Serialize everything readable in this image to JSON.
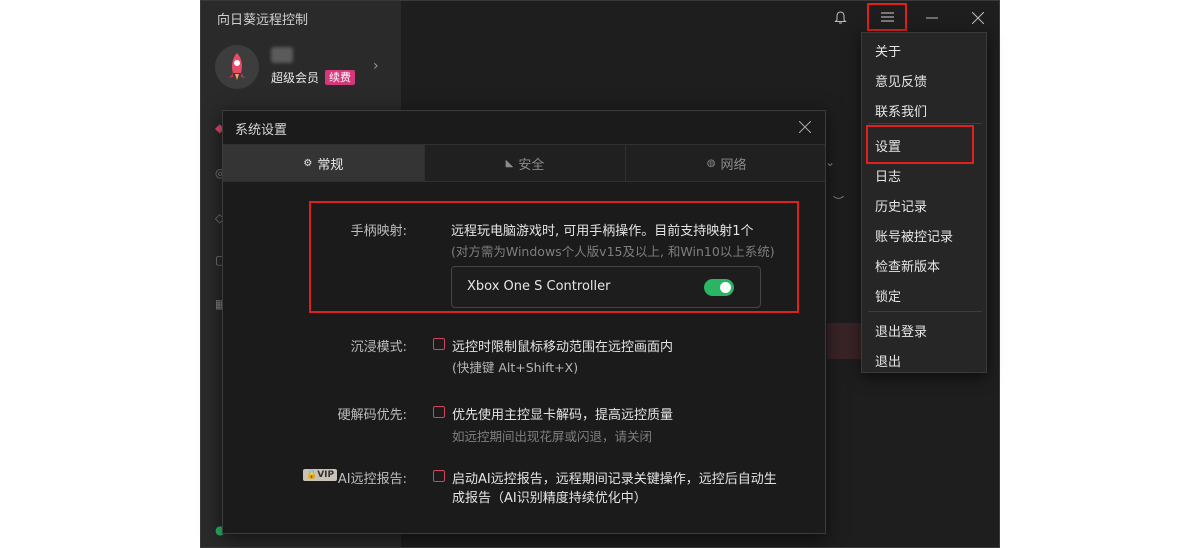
{
  "app": {
    "title": "向日葵远程控制",
    "member_label": "超级会员",
    "renew_badge": "续费"
  },
  "dialog": {
    "title": "系统设置",
    "tabs": [
      {
        "label": "常规",
        "icon": "gear-icon",
        "active": true
      },
      {
        "label": "安全",
        "icon": "shield-icon",
        "active": false
      },
      {
        "label": "网络",
        "icon": "globe-icon",
        "active": false
      }
    ],
    "gamepad": {
      "label": "手柄映射:",
      "text": "远程玩电脑游戏时, 可用手柄操作。目前支持映射1个",
      "sub": "(对方需为Windows个人版v15及以上, 和Win10以上系统)",
      "device": "Xbox One S Controller",
      "enabled": true
    },
    "immersive": {
      "label": "沉浸模式:",
      "text": "远控时限制鼠标移动范围在远控画面内",
      "sub": "(快捷键 Alt+Shift+X)",
      "checked": false
    },
    "hw_decode": {
      "label": "硬解码优先:",
      "text": "优先使用主控显卡解码，提高远控质量",
      "sub": "如远控期间出现花屏或闪退，请关闭",
      "checked": false
    },
    "ai_report": {
      "vip": "VIP",
      "label": "AI远控报告:",
      "text_line1": "启动AI远控报告，远程期间记录关键操作，远控后自动生",
      "text_line2": "成报告（AI识别精度持续优化中）",
      "checked": false
    }
  },
  "menu": {
    "items": [
      "关于",
      "意见反馈",
      "联系我们",
      "设置",
      "日志",
      "历史记录",
      "账号被控记录",
      "检查新版本",
      "锁定",
      "退出登录",
      "退出"
    ]
  },
  "colors": {
    "accent_red": "#e0201e",
    "toggle_on": "#2bb463",
    "badge_pink": "#d4387a"
  }
}
